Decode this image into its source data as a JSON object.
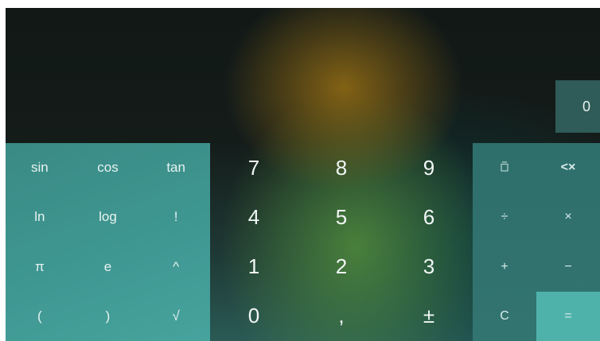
{
  "display": {
    "value": "0"
  },
  "functions": [
    "sin",
    "cos",
    "tan",
    "ln",
    "log",
    "!",
    "π",
    "e",
    "^",
    "(",
    ")",
    "√"
  ],
  "numbers": [
    "7",
    "8",
    "9",
    "4",
    "5",
    "6",
    "1",
    "2",
    "3",
    "0",
    ",",
    "±"
  ],
  "operators": {
    "memory_icon": "clipboard-icon",
    "backspace": "<×",
    "divide": "÷",
    "multiply": "×",
    "plus": "+",
    "minus": "−",
    "clear": "C",
    "equals": "="
  },
  "colors": {
    "function_panel": "#3f9792",
    "operator_panel": "#2f6f6b",
    "equals_key": "#4fb2aa",
    "display_value_bg": "#2f5b58"
  }
}
